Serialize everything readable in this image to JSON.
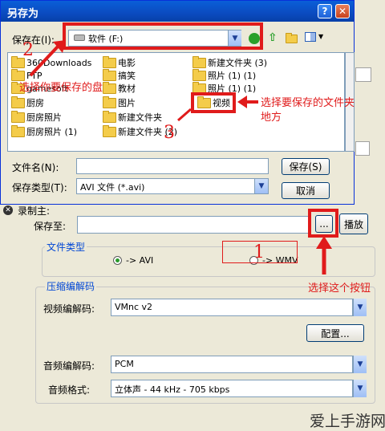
{
  "dialog": {
    "title": "另存为",
    "help_glyph": "?",
    "close_glyph": "✕",
    "save_in_label": "保存在(I):",
    "save_in_value": "软件  (F:)",
    "files": [
      {
        "label": "360Downloads"
      },
      {
        "label": "FTP"
      },
      {
        "label": "gamesoft"
      },
      {
        "label": "厨房"
      },
      {
        "label": "厨房照片"
      },
      {
        "label": "厨房照片 (1)"
      },
      {
        "label": "电影"
      },
      {
        "label": "搞笑"
      },
      {
        "label": "教材"
      },
      {
        "label": "图片"
      },
      {
        "label": "新建文件夹"
      },
      {
        "label": "新建文件夹 (2)"
      },
      {
        "label": "新建文件夹 (3)"
      },
      {
        "label": "照片 (1) (1)"
      },
      {
        "label": "照片 (1) (1)"
      },
      {
        "label": "视频"
      }
    ],
    "filename_label": "文件名(N):",
    "filename_value": "",
    "filetype_label": "保存类型(T):",
    "filetype_value": "AVI 文件 (*.avi)",
    "save_button": "保存(S)",
    "cancel_button": "取消"
  },
  "app": {
    "section_label": "录制主:",
    "save_to_label": "保存至:",
    "browse_button": "...",
    "play_button": "播放",
    "filetype_group": "文件类型",
    "radio_avi": "-> AVI",
    "radio_wmv": "-> WMV",
    "compress_group": "压缩编解码",
    "video_codec_label": "视频编解码:",
    "video_codec_value": "VMnc v2",
    "config_button": "配置...",
    "audio_codec_label": "音频编解码:",
    "audio_codec_value": "PCM",
    "audio_format_label": "音频格式:",
    "audio_format_value": "立体声 - 44 kHz - 705 kbps"
  },
  "annotations": {
    "step1": "1",
    "step2": "2",
    "step3": "3",
    "note_save_location": "选择你要保存的盘",
    "note_folder_line1": "选择要保存的文件夹",
    "note_folder_line2": "地方",
    "note_button": "选择这个按钮"
  },
  "watermark": "爱上手游网",
  "colors": {
    "annotation_red": "#e01b1b",
    "title_blue": "#0a5fd8",
    "group_blue": "#0046d5"
  }
}
